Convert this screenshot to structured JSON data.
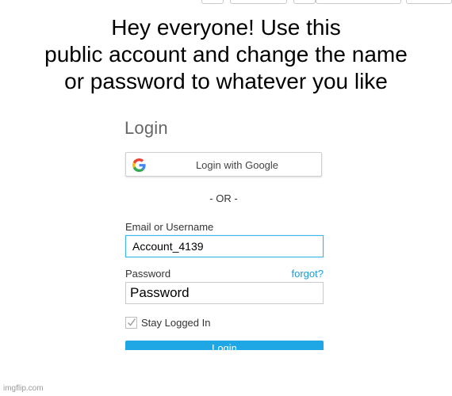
{
  "meme": {
    "caption_lines": [
      "Hey everyone! Use this",
      "public account and change the name",
      "or password to whatever you like"
    ]
  },
  "login_form": {
    "title": "Login",
    "google_button_label": "Login with Google",
    "divider_text": "- OR -",
    "email_label": "Email or Username",
    "email_value": "Account_4139",
    "password_label": "Password",
    "forgot_link": "forgot?",
    "password_value": "Password",
    "stay_logged_in_label": "Stay Logged In",
    "stay_logged_in_checked": true,
    "login_button_label": "Login",
    "accent_color": "#1ea7e4",
    "link_color": "#1a9bd7"
  },
  "footer": {
    "watermark": "imgflip.com"
  }
}
